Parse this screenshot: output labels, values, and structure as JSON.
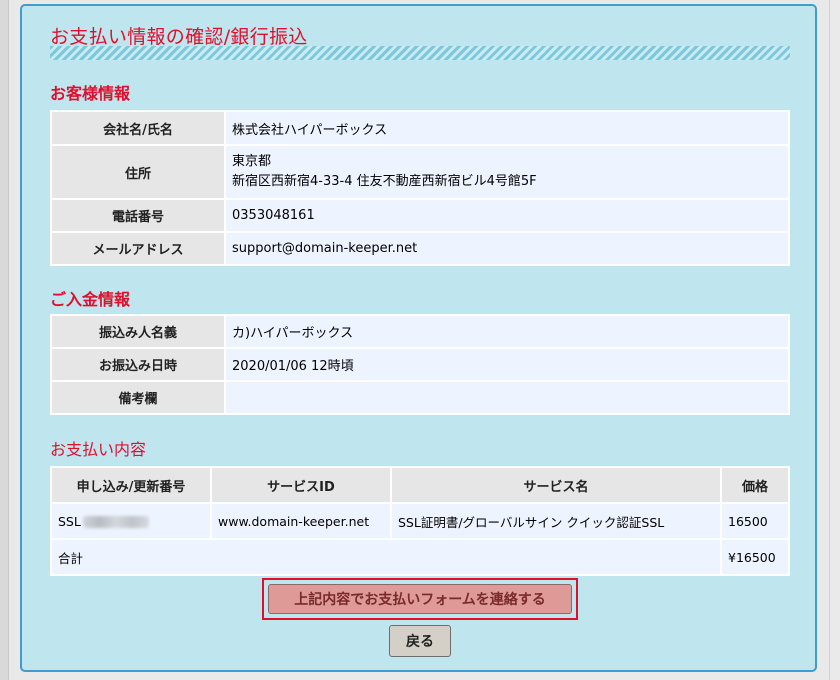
{
  "page": {
    "title": "お支払い情報の確認/銀行振込"
  },
  "customer": {
    "heading": "お客様情報",
    "company_label": "会社名/氏名",
    "company": "株式会社ハイパーボックス",
    "address_label": "住所",
    "address_line1": "東京都",
    "address_line2": "新宿区西新宿4-33-4 住友不動産西新宿ビル4号館5F",
    "phone_label": "電話番号",
    "phone": "0353048161",
    "email_label": "メールアドレス",
    "email": "support@domain-keeper.net"
  },
  "deposit": {
    "heading": "ご入金情報",
    "payer_label": "振込み人名義",
    "payer": "カ)ハイパーボックス",
    "datetime_label": "お振込み日時",
    "datetime": "2020/01/06 12時頃",
    "notes_label": "備考欄",
    "notes": ""
  },
  "payment": {
    "heading": "お支払い内容",
    "headers": {
      "number": "申し込み/更新番号",
      "service_id": "サービスID",
      "service_name": "サービス名",
      "price": "価格"
    },
    "rows": [
      {
        "number_prefix": "SSL",
        "service_id": "www.domain-keeper.net",
        "service_name": "SSL証明書/グローバルサイン クイック認証SSL",
        "price": "16500"
      }
    ],
    "total_label": "合計",
    "total_value": "¥16500"
  },
  "actions": {
    "submit_label": "上記内容でお支払いフォームを連絡する",
    "back_label": "戻る"
  },
  "colors": {
    "accent_red": "#e0102c",
    "panel_bg": "#bfe6ef",
    "panel_border": "#3f9ccf"
  }
}
